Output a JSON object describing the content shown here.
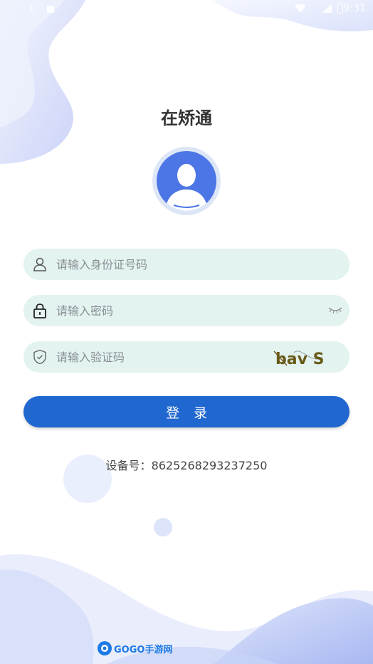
{
  "status_bar": {
    "time": "9:31",
    "left_text": "1"
  },
  "app": {
    "title": "在矫通"
  },
  "form": {
    "id_placeholder": "请输入身份证号码",
    "password_placeholder": "请输入密码",
    "captcha_placeholder": "请输入验证码",
    "captcha_text": "bav S",
    "login_label": "登录"
  },
  "device": {
    "label": "设备号：",
    "number": "8625268293237250"
  },
  "watermark": {
    "brand": "GOGO手游网"
  },
  "icons": {
    "user": "user-icon",
    "lock": "lock-icon",
    "shield": "shield-icon",
    "eye": "eye-closed-icon",
    "avatar": "avatar-silhouette"
  },
  "colors": {
    "accent": "#2067cf",
    "field_bg": "#e2f3f0",
    "avatar_bg": "#4c76e6"
  }
}
